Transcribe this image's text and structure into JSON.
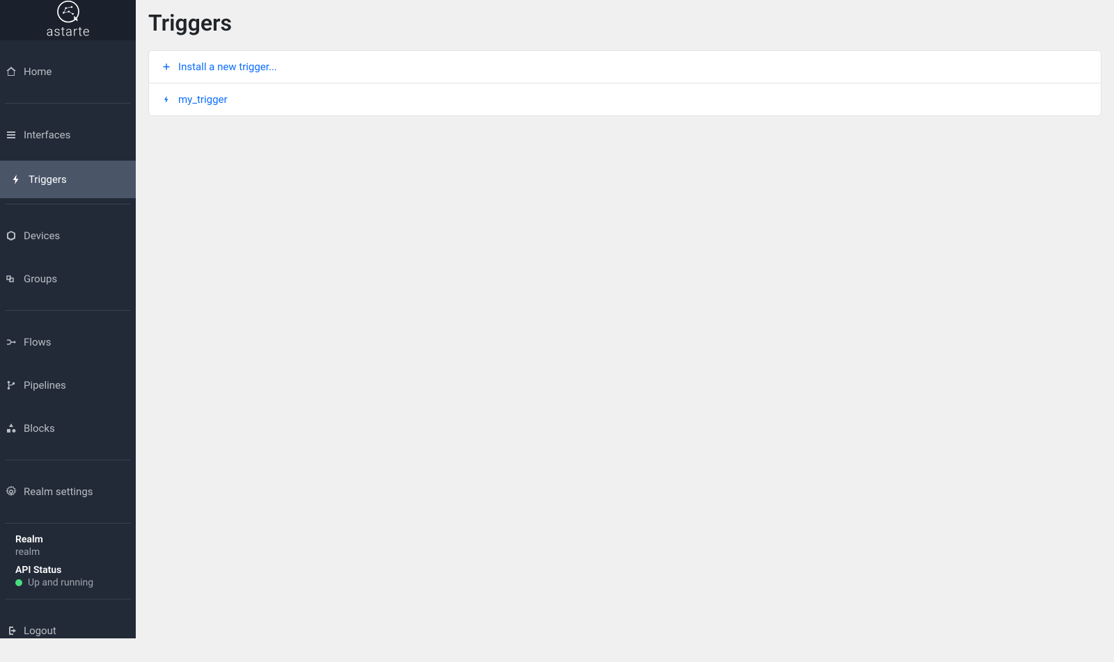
{
  "brand": "astarte",
  "sidebar": {
    "home": "Home",
    "interfaces": "Interfaces",
    "triggers": "Triggers",
    "devices": "Devices",
    "groups": "Groups",
    "flows": "Flows",
    "pipelines": "Pipelines",
    "blocks": "Blocks",
    "realm_settings": "Realm settings",
    "logout": "Logout"
  },
  "status": {
    "realm_label": "Realm",
    "realm_value": "realm",
    "api_label": "API Status",
    "api_value": "Up and running"
  },
  "page": {
    "title": "Triggers",
    "install_new": "Install a new trigger...",
    "triggers": [
      {
        "name": "my_trigger"
      }
    ]
  }
}
